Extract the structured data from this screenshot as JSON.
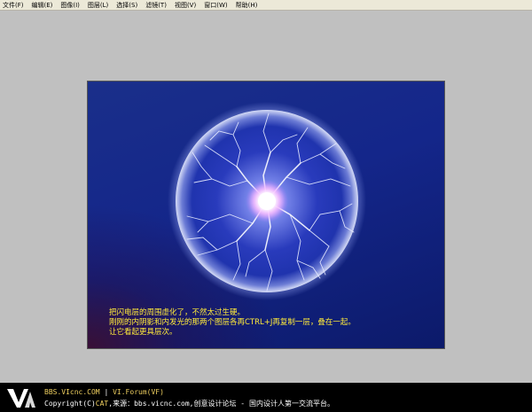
{
  "menu": {
    "items": [
      {
        "label": "文件(F)"
      },
      {
        "label": "编辑(E)"
      },
      {
        "label": "图像(I)"
      },
      {
        "label": "图层(L)"
      },
      {
        "label": "选择(S)"
      },
      {
        "label": "滤镜(T)"
      },
      {
        "label": "视图(V)"
      },
      {
        "label": "窗口(W)"
      },
      {
        "label": "帮助(H)"
      }
    ]
  },
  "canvas": {
    "caption": {
      "line1": "把闪电层的周围虚化了，不然太过生硬。",
      "line2": "刚刚的内阴影和内发光的那两个图层各再CTRL+J再复制一层，叠在一起。",
      "line3": "让它看起更具层次。"
    }
  },
  "footer": {
    "site": "BBS.VIcnc.COM",
    "separator": "|",
    "forum": "VI.Forum(VF)",
    "copyright_prefix": "Copyright(C)",
    "cat": "CAT",
    "copyright_rest": ",来源：bbs.vicnc.com,创意设计论坛 - 国内设计人第一交流平台。"
  },
  "colors": {
    "caption": "#ffea3a",
    "canvas_bg": "#14268a",
    "workspace": "#c0c0c0",
    "footer_bg": "#000000"
  }
}
